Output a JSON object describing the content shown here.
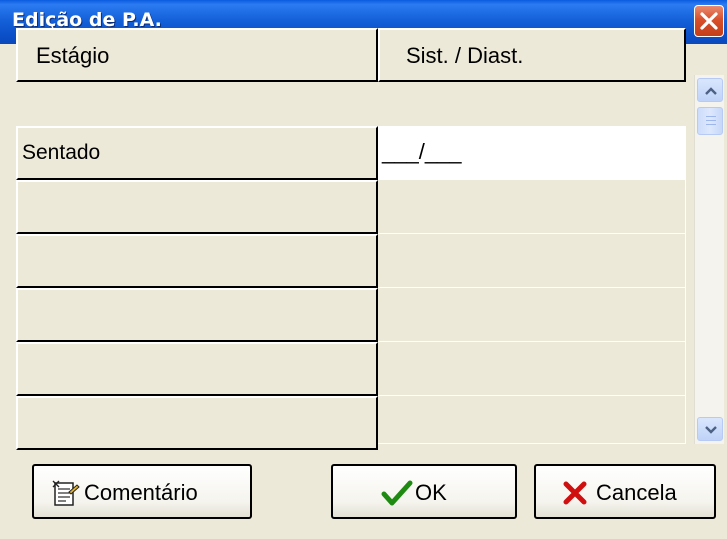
{
  "window": {
    "title": "Edição de P.A."
  },
  "table": {
    "columns": [
      "Estágio",
      "Sist. / Diast."
    ],
    "rows": [
      {
        "stage": "Sentado",
        "value": "___/___"
      },
      {
        "stage": "",
        "value": ""
      },
      {
        "stage": "",
        "value": ""
      },
      {
        "stage": "",
        "value": ""
      },
      {
        "stage": "",
        "value": ""
      },
      {
        "stage": "",
        "value": ""
      }
    ]
  },
  "buttons": {
    "comment_label": "Comentário",
    "ok_label": "OK",
    "cancel_label": "Cancela"
  },
  "icons": {
    "close": "close-icon",
    "comment": "notepad-icon",
    "ok": "checkmark-icon",
    "cancel": "red-x-icon",
    "scroll_up": "chevron-up-icon",
    "scroll_down": "chevron-down-icon"
  },
  "colors": {
    "titlebar": "#0A58D8",
    "close_button": "#D7502C",
    "dialog_bg": "#ECE9D8",
    "ok_check": "#1F8A12",
    "cancel_x": "#D01010"
  }
}
